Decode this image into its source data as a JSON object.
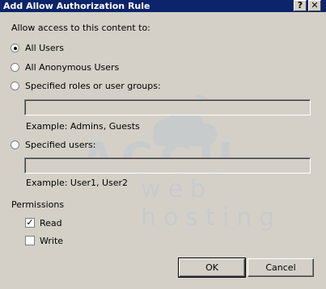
{
  "window": {
    "title": "Add Allow Authorization Rule",
    "help_glyph": "?",
    "close_glyph": "✕"
  },
  "access": {
    "prompt": "Allow access to this content to:",
    "options": [
      {
        "label": "All Users",
        "selected": true
      },
      {
        "label": "All Anonymous Users",
        "selected": false
      },
      {
        "label": "Specified roles or user groups:",
        "selected": false
      },
      {
        "label": "Specified users:",
        "selected": false
      }
    ],
    "roles_field": {
      "value": "",
      "example": "Example: Admins, Guests"
    },
    "users_field": {
      "value": "",
      "example": "Example: User1, User2"
    }
  },
  "permissions": {
    "heading": "Permissions",
    "items": [
      {
        "label": "Read",
        "checked": true,
        "mark": "✓"
      },
      {
        "label": "Write",
        "checked": false,
        "mark": ""
      }
    ]
  },
  "buttons": {
    "ok": "OK",
    "cancel": "Cancel"
  },
  "watermark": {
    "brand": "ACCU",
    "tagline": "web hosting",
    "color": "#b9c6d3"
  }
}
